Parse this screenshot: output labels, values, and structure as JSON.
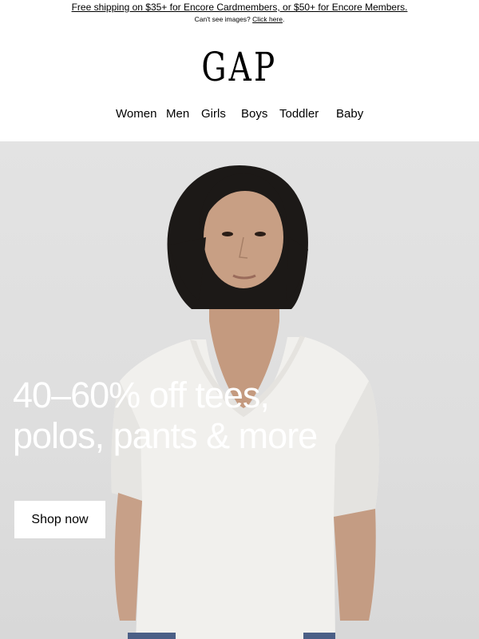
{
  "header": {
    "promo_text": "Free shipping on $35+ for Encore Cardmembers, or $50+ for Encore Members.",
    "cant_see_text": "Can't see images?",
    "click_here": "Click here",
    "period": "."
  },
  "brand": {
    "logo_text": "GAP"
  },
  "nav": {
    "items": [
      {
        "label": "Women"
      },
      {
        "label": "Men"
      },
      {
        "label": "Girls"
      },
      {
        "label": "Boys"
      },
      {
        "label": "Toddler"
      },
      {
        "label": "Baby"
      }
    ]
  },
  "hero": {
    "headline_line1": "40–60% off tees,",
    "headline_line2": "polos, pants & more",
    "cta_label": "Shop now"
  },
  "colors": {
    "hero_background": "#dedede",
    "headline": "#ffffff",
    "cta_background": "#ffffff"
  }
}
